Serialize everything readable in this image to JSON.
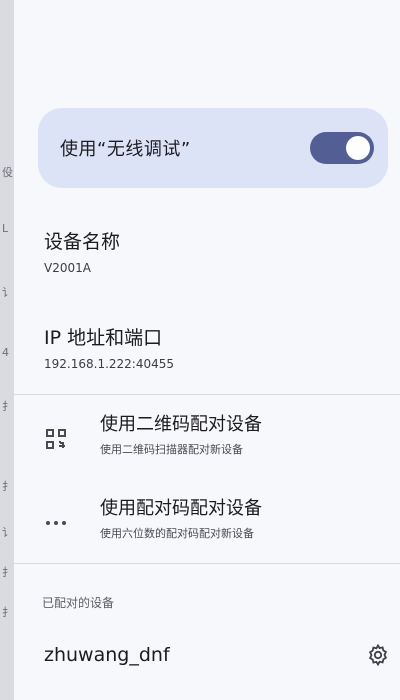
{
  "left_strip": {
    "fragments": [
      "伇",
      "L",
      "讠",
      "4",
      "扌",
      "扌",
      "讠",
      "扌",
      "扌"
    ]
  },
  "wireless_debug": {
    "label": "使用“无线调试”",
    "enabled": true,
    "accent": "#535f94"
  },
  "device_name": {
    "title": "设备名称",
    "value": "V2001A"
  },
  "ip_port": {
    "title": "IP 地址和端口",
    "value": "192.168.1.222:40455"
  },
  "qr_pair": {
    "icon": "qr-code-scanner-icon",
    "title": "使用二维码配对设备",
    "subtitle": "使用二维码扫描器配对新设备"
  },
  "code_pair": {
    "icon": "dots-icon",
    "title": "使用配对码配对设备",
    "subtitle": "使用六位数的配对码配对新设备"
  },
  "paired_devices": {
    "header": "已配对的设备",
    "items": [
      {
        "name": "zhuwang_dnf",
        "icon": "gear-icon"
      }
    ]
  }
}
